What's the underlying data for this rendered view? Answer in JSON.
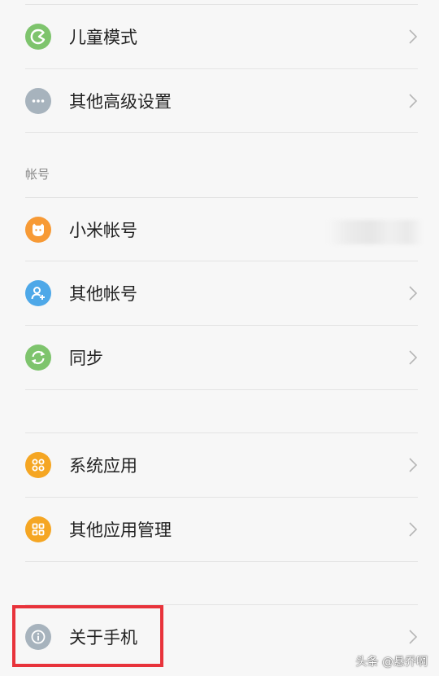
{
  "items": [
    {
      "label": "儿童模式",
      "icon": "kids-mode-icon",
      "color": "#7ec46d"
    },
    {
      "label": "其他高级设置",
      "icon": "more-icon",
      "color": "#a7b3bd"
    },
    {
      "label": "小米帐号",
      "icon": "mi-account-icon",
      "color": "#f79a35"
    },
    {
      "label": "其他帐号",
      "icon": "other-account-icon",
      "color": "#4ea8e8"
    },
    {
      "label": "同步",
      "icon": "sync-icon",
      "color": "#7ec46d"
    },
    {
      "label": "系统应用",
      "icon": "system-apps-icon",
      "color": "#f5a623"
    },
    {
      "label": "其他应用管理",
      "icon": "app-management-icon",
      "color": "#f5a623"
    },
    {
      "label": "关于手机",
      "icon": "info-icon",
      "color": "#a7b3bd"
    }
  ],
  "section_account": "帐号",
  "watermark": "头条 @悬乔啊",
  "highlight_color": "#e8333b"
}
